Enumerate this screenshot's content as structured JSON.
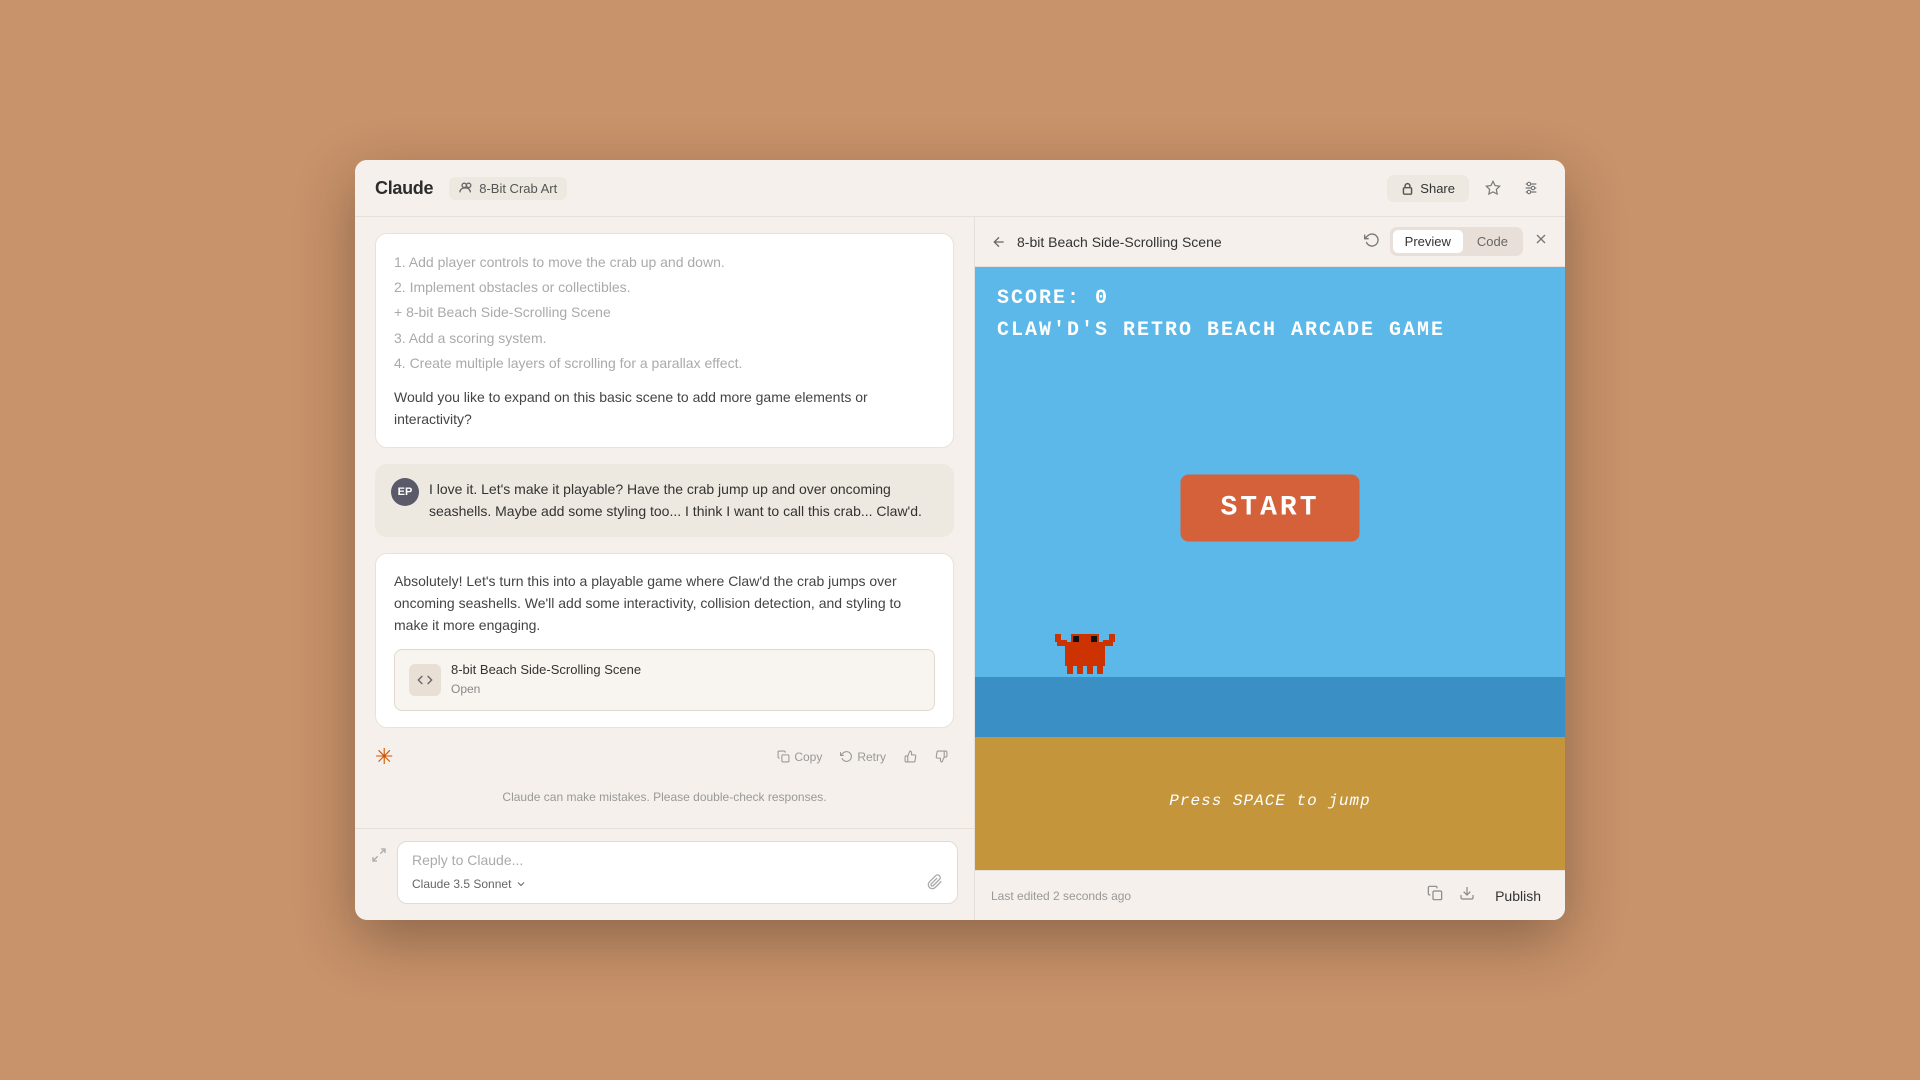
{
  "header": {
    "logo": "Claude",
    "project_name": "8-Bit Crab Art",
    "share_label": "Share"
  },
  "chat": {
    "messages": [
      {
        "type": "assistant",
        "items": [
          "1. Add player controls to move the crab up and down.",
          "2. Implement obstacles or collectibles.",
          "+ 8-bit Beach Side-Scrolling Scene",
          "3. Add a scoring system.",
          "4. Create multiple layers of scrolling for a parallax effect."
        ],
        "body": "Would you like to expand on this basic scene to add more game elements or interactivity?"
      },
      {
        "type": "user",
        "avatar": "EP",
        "text": "I love it. Let's make it playable? Have the crab jump up and over oncoming seashells. Maybe add some styling too... I think I want to call this crab... Claw'd."
      },
      {
        "type": "assistant",
        "text": "Absolutely! Let's turn this into a playable game where Claw'd the crab jumps over oncoming seashells. We'll add some interactivity, collision detection, and styling to make it more engaging.",
        "artifact": {
          "title": "8-bit Beach Side-Scrolling Scene",
          "sub": "Open"
        }
      }
    ],
    "actions": {
      "copy": "Copy",
      "retry": "Retry"
    },
    "disclaimer": "Claude can make mistakes. Please double-check responses.",
    "input_placeholder": "Reply to Claude...",
    "model_label": "Claude 3.5 Sonnet"
  },
  "preview": {
    "title": "8-bit Beach Side-Scrolling Scene",
    "tabs": [
      "Preview",
      "Code"
    ],
    "active_tab": "Preview",
    "game": {
      "score": "SCORE: 0",
      "game_title": "CLAW'D'S RETRO BEACH ARCADE GAME",
      "start_button": "START",
      "press_space": "Press SPACE to jump"
    },
    "footer": {
      "last_edited": "Last edited 2 seconds ago",
      "publish": "Publish"
    }
  }
}
